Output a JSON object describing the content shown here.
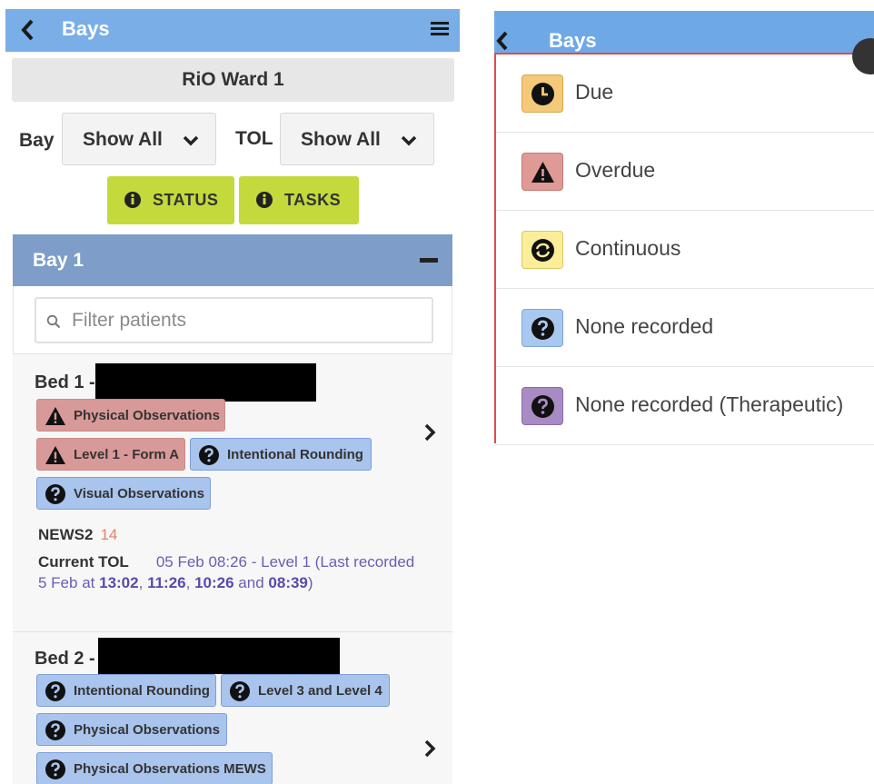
{
  "left_screen": {
    "header": {
      "title": "Bays",
      "back_icon": "chevron-left-icon",
      "menu_icon": "hamburger-menu-icon"
    },
    "ward": "RiO Ward 1",
    "filters": {
      "bay_label": "Bay",
      "bay_value": "Show All",
      "tol_label": "TOL",
      "tol_value": "Show All"
    },
    "buttons": {
      "status": "STATUS",
      "tasks": "TASKS"
    },
    "bay_section": {
      "title": "Bay 1",
      "collapse_icon": "minus-icon"
    },
    "search": {
      "placeholder": "Filter patients"
    },
    "beds": [
      {
        "name": "Bed 1 -",
        "tags": [
          {
            "label": "Physical Observations",
            "status": "overdue"
          },
          {
            "label": "Level 1 - Form A",
            "status": "overdue"
          },
          {
            "label": "Intentional Rounding",
            "status": "none"
          },
          {
            "label": "Visual Observations",
            "status": "none"
          }
        ],
        "news2_label": "NEWS2",
        "news2_value": "14",
        "tol_label": "Current TOL",
        "tol_text": "05 Feb 08:26 - Level 1 (Last recorded 5 Feb at",
        "tol_times": [
          "13:02",
          "11:26",
          "10:26",
          "08:39"
        ],
        "tol_sep1": ",",
        "tol_sep2": ",",
        "tol_and": "and",
        "tol_close": ")"
      },
      {
        "name": "Bed 2 -",
        "tags": [
          {
            "label": "Intentional Rounding",
            "status": "none"
          },
          {
            "label": "Level 3 and Level 4",
            "status": "none"
          },
          {
            "label": "Physical Observations",
            "status": "none"
          },
          {
            "label": "Physical Observations MEWS",
            "status": "none"
          }
        ]
      }
    ]
  },
  "right_screen": {
    "header": {
      "title": "Bays"
    },
    "legend": [
      {
        "label": "Due",
        "icon": "clock-icon",
        "color": "#f5c97a"
      },
      {
        "label": "Overdue",
        "icon": "warning-triangle-icon",
        "color": "#e09a96"
      },
      {
        "label": "Continuous",
        "icon": "continuous-cycle-icon",
        "color": "#fbed9a"
      },
      {
        "label": "None recorded",
        "icon": "question-icon",
        "color": "#a9c8f0"
      },
      {
        "label": "None recorded (Therapeutic)",
        "icon": "question-icon",
        "color": "#a98bc4"
      }
    ]
  }
}
